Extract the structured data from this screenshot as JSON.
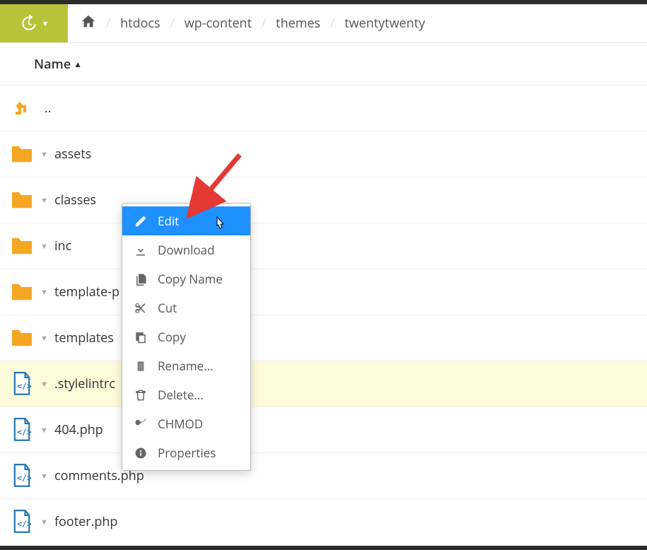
{
  "breadcrumb": {
    "items": [
      "htdocs",
      "wp-content",
      "themes",
      "twentytwenty"
    ]
  },
  "column": {
    "name_label": "Name"
  },
  "files": {
    "up": "..",
    "rows": [
      {
        "name": "assets",
        "type": "folder"
      },
      {
        "name": "classes",
        "type": "folder"
      },
      {
        "name": "inc",
        "type": "folder"
      },
      {
        "name": "template-p",
        "type": "folder"
      },
      {
        "name": "templates",
        "type": "folder"
      },
      {
        "name": ".stylelintrc",
        "type": "code",
        "selected": true
      },
      {
        "name": "404.php",
        "type": "code"
      },
      {
        "name": "comments.php",
        "type": "code"
      },
      {
        "name": "footer.php",
        "type": "code"
      }
    ]
  },
  "context_menu": {
    "items": [
      {
        "label": "Edit",
        "icon": "edit-icon",
        "highlight": true
      },
      {
        "label": "Download",
        "icon": "download-icon"
      },
      {
        "label": "Copy Name",
        "icon": "copy-name-icon"
      },
      {
        "label": "Cut",
        "icon": "cut-icon"
      },
      {
        "label": "Copy",
        "icon": "copy-icon"
      },
      {
        "label": "Rename...",
        "icon": "rename-icon"
      },
      {
        "label": "Delete...",
        "icon": "delete-icon"
      },
      {
        "label": "CHMOD",
        "icon": "chmod-icon"
      },
      {
        "label": "Properties",
        "icon": "info-icon"
      }
    ]
  }
}
